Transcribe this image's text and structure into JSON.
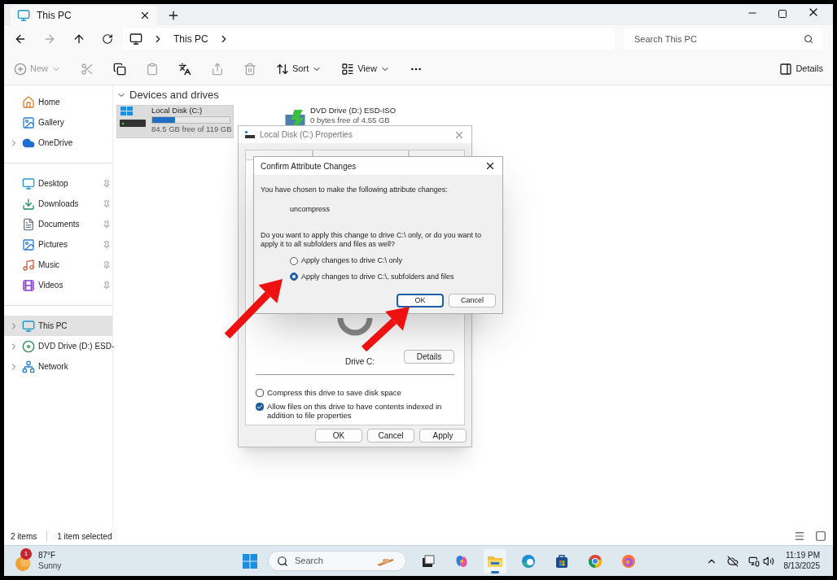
{
  "window": {
    "tab_title": "This PC"
  },
  "address": {
    "path": [
      "This PC"
    ],
    "search_placeholder": "Search This PC"
  },
  "toolbar": {
    "new": "New",
    "sort": "Sort",
    "view": "View",
    "details": "Details"
  },
  "sidebar": {
    "groups": [
      [
        {
          "label": "Home",
          "expandable": false,
          "pinned": false,
          "selected": false
        },
        {
          "label": "Gallery",
          "expandable": false,
          "pinned": false,
          "selected": false
        },
        {
          "label": "OneDrive",
          "expandable": true,
          "pinned": false,
          "selected": false
        }
      ],
      [
        {
          "label": "Desktop",
          "expandable": false,
          "pinned": true,
          "selected": false
        },
        {
          "label": "Downloads",
          "expandable": false,
          "pinned": true,
          "selected": false
        },
        {
          "label": "Documents",
          "expandable": false,
          "pinned": true,
          "selected": false
        },
        {
          "label": "Pictures",
          "expandable": false,
          "pinned": true,
          "selected": false
        },
        {
          "label": "Music",
          "expandable": false,
          "pinned": true,
          "selected": false
        },
        {
          "label": "Videos",
          "expandable": false,
          "pinned": true,
          "selected": false
        }
      ],
      [
        {
          "label": "This PC",
          "expandable": true,
          "pinned": false,
          "selected": true
        },
        {
          "label": "DVD Drive (D:) ESD-",
          "expandable": true,
          "pinned": false,
          "selected": false
        },
        {
          "label": "Network",
          "expandable": true,
          "pinned": false,
          "selected": false
        }
      ]
    ]
  },
  "section": {
    "title": "Devices and drives",
    "expanded": true
  },
  "drives": [
    {
      "kind": "disk",
      "name": "Local Disk (C:)",
      "free_text": "84.5 GB free of 119 GB",
      "level": 0.29,
      "selected": true
    },
    {
      "kind": "dvd",
      "name": "DVD Drive (D:) ESD-ISO",
      "free_text": "0 bytes free of 4.55 GB",
      "selected": false
    }
  ],
  "properties_dialog": {
    "title": "Local Disk (C:) Properties",
    "drive_label": "Drive C:",
    "details_button": "Details",
    "options": [
      {
        "label": "Compress this drive to save disk space",
        "checked": false
      },
      {
        "label": "Allow files on this drive to have contents indexed in addition to file properties",
        "checked": true
      }
    ],
    "buttons": [
      "OK",
      "Cancel",
      "Apply"
    ]
  },
  "confirm_dialog": {
    "title": "Confirm Attribute Changes",
    "intro": "You have chosen to make the following attribute changes:",
    "change": "uncompress",
    "question": "Do you want to apply this change to drive C:\\ only, or do you want to apply it to all subfolders and files as well?",
    "options": [
      {
        "label": "Apply changes to drive C:\\ only",
        "selected": false
      },
      {
        "label": "Apply changes to drive C:\\, subfolders and files",
        "selected": true
      }
    ],
    "buttons": [
      {
        "label": "OK",
        "default": true
      },
      {
        "label": "Cancel",
        "default": false
      }
    ]
  },
  "status_bar": {
    "count": "2 items",
    "selection": "1 item selected"
  },
  "taskbar": {
    "weather": {
      "temperature": "87°F",
      "condition": "Sunny",
      "badge": "1"
    },
    "search_placeholder": "Search",
    "apps": [
      {
        "kind": "taskview",
        "active": false
      },
      {
        "kind": "copilot",
        "active": false
      },
      {
        "kind": "explorer",
        "active": true
      },
      {
        "kind": "edge",
        "active": false
      },
      {
        "kind": "store",
        "active": false
      },
      {
        "kind": "chrome",
        "active": false
      },
      {
        "kind": "firefox",
        "active": false
      }
    ],
    "clock": {
      "time": "11:19 PM",
      "date": "8/13/2025"
    }
  }
}
